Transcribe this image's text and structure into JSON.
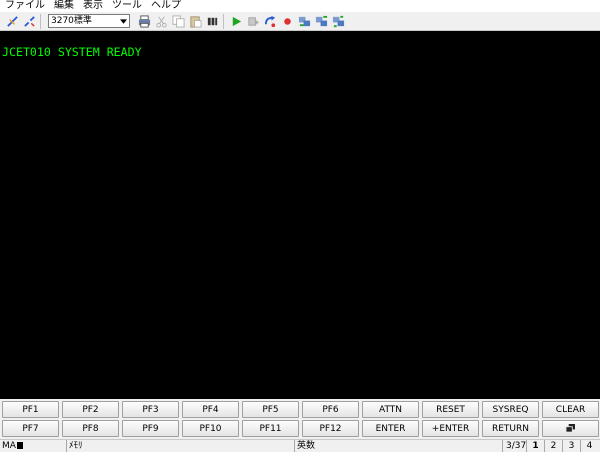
{
  "menu": [
    "ファイル",
    "編集",
    "表示",
    "ツール",
    "ヘルプ"
  ],
  "toolbar": {
    "connect_icon": "connect-icon",
    "disconnect_icon": "disconnect-icon",
    "profile_value": "3270標準",
    "icons": [
      "print-icon",
      "cut-icon",
      "copy-icon",
      "paste-icon",
      "macro-icon",
      "play-icon",
      "step-icon",
      "record-loop-icon",
      "record-icon",
      "transfer-send-icon",
      "transfer-receive-icon",
      "transfer-multi-icon"
    ]
  },
  "terminal": {
    "line1": "JCET010 SYSTEM READY",
    "text_color": "#00ff00",
    "background": "#000000"
  },
  "keypad": {
    "row1": [
      "PF1",
      "PF2",
      "PF3",
      "PF4",
      "PF5",
      "PF6",
      "ATTN",
      "RESET",
      "SYSREQ",
      "CLEAR"
    ],
    "row2": [
      "PF7",
      "PF8",
      "PF9",
      "PF10",
      "PF11",
      "PF12",
      "ENTER",
      "+ENTER",
      "RETURN",
      ""
    ]
  },
  "status": {
    "mode": "MA",
    "field2": "ﾒﾓﾘ",
    "input_mode": "英数",
    "cursor_pos": "3/37",
    "sessions": [
      "1",
      "2",
      "3",
      "4"
    ],
    "active_session": "1"
  }
}
